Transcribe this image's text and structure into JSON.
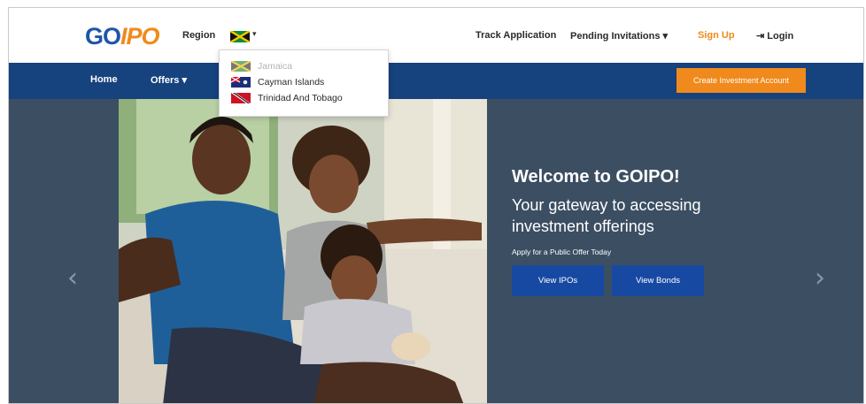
{
  "header": {
    "logo": {
      "part1": "GO",
      "part2": "IPO"
    },
    "region_label": "Region",
    "region_flag": "jamaica-flag",
    "region_caret": "▾",
    "nav": {
      "track": "Track Application",
      "pending": "Pending Invitations ▾",
      "signup": "Sign Up",
      "login": "⇥ Login"
    }
  },
  "navbar": {
    "home": "Home",
    "offers": "Offers ▾",
    "cta": "Create Investment Account"
  },
  "region_dropdown": {
    "items": [
      {
        "label": "Jamaica",
        "flag": "jamaica-flag",
        "state": "selected"
      },
      {
        "label": "Cayman Islands",
        "flag": "cayman-flag"
      },
      {
        "label": "Trinidad And Tobago",
        "flag": "trinidad-flag"
      }
    ]
  },
  "hero": {
    "title": "Welcome to GOIPO!",
    "subtitle": "Your gateway to accessing investment offerings",
    "small": "Apply for a Public Offer Today",
    "buttons": {
      "ipos": "View IPOs",
      "bonds": "View Bonds"
    },
    "prev_arrow": "‹",
    "next_arrow": "›"
  },
  "colors": {
    "brand_blue": "#16427e",
    "brand_orange": "#f08a1c",
    "hero_bg": "#3c4e62",
    "hero_button": "#1749a2"
  }
}
